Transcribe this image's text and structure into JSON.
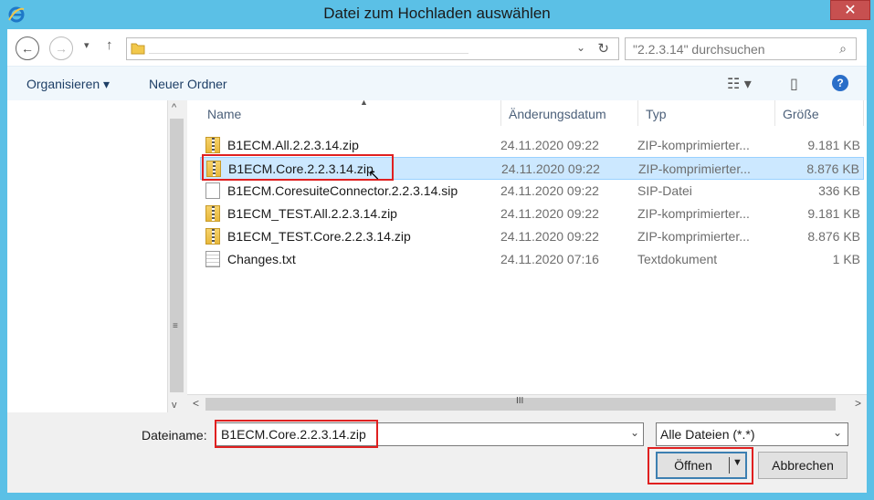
{
  "window": {
    "title": "Datei zum Hochladen auswählen",
    "close_label": "✕",
    "accent": "#5bc0e6"
  },
  "nav": {
    "back_icon": "←",
    "forward_icon": "→",
    "recent_icon": "▾",
    "up_icon": "↑",
    "address_dropdown": "⌄",
    "refresh_icon": "↻",
    "search_placeholder": "\"2.2.3.14\" durchsuchen",
    "search_icon": "⌕"
  },
  "toolbar": {
    "organize": "Organisieren ▾",
    "new_folder": "Neuer Ordner",
    "view_icon": "☷ ▾",
    "pane_icon": "▯",
    "help_icon": "?"
  },
  "columns": {
    "name": "Name",
    "date": "Änderungsdatum",
    "type": "Typ",
    "size": "Größe"
  },
  "files": [
    {
      "name": "B1ECM.All.2.2.3.14.zip",
      "date": "24.11.2020 09:22",
      "type": "ZIP-komprimierter...",
      "size": "9.181 KB",
      "icon": "zip-folder-icon"
    },
    {
      "name": "B1ECM.Core.2.2.3.14.zip",
      "date": "24.11.2020 09:22",
      "type": "ZIP-komprimierter...",
      "size": "8.876 KB",
      "icon": "zip-folder-icon"
    },
    {
      "name": "B1ECM.CoresuiteConnector.2.2.3.14.sip",
      "date": "24.11.2020 09:22",
      "type": "SIP-Datei",
      "size": "336 KB",
      "icon": "document-icon"
    },
    {
      "name": "B1ECM_TEST.All.2.2.3.14.zip",
      "date": "24.11.2020 09:22",
      "type": "ZIP-komprimierter...",
      "size": "9.181 KB",
      "icon": "zip-folder-icon"
    },
    {
      "name": "B1ECM_TEST.Core.2.2.3.14.zip",
      "date": "24.11.2020 09:22",
      "type": "ZIP-komprimierter...",
      "size": "8.876 KB",
      "icon": "zip-folder-icon"
    },
    {
      "name": "Changes.txt",
      "date": "24.11.2020 07:16",
      "type": "Textdokument",
      "size": "1 KB",
      "icon": "text-document-icon"
    }
  ],
  "footer": {
    "filename_label": "Dateiname:",
    "filename_value": "B1ECM.Core.2.2.3.14.zip",
    "filter_value": "Alle Dateien (*.*)",
    "open_label": "Öffnen",
    "cancel_label": "Abbrechen"
  },
  "scroll": {
    "up": "^",
    "down": "v",
    "left": "<",
    "right": ">",
    "v_grip": "≡",
    "h_grip": "III"
  }
}
